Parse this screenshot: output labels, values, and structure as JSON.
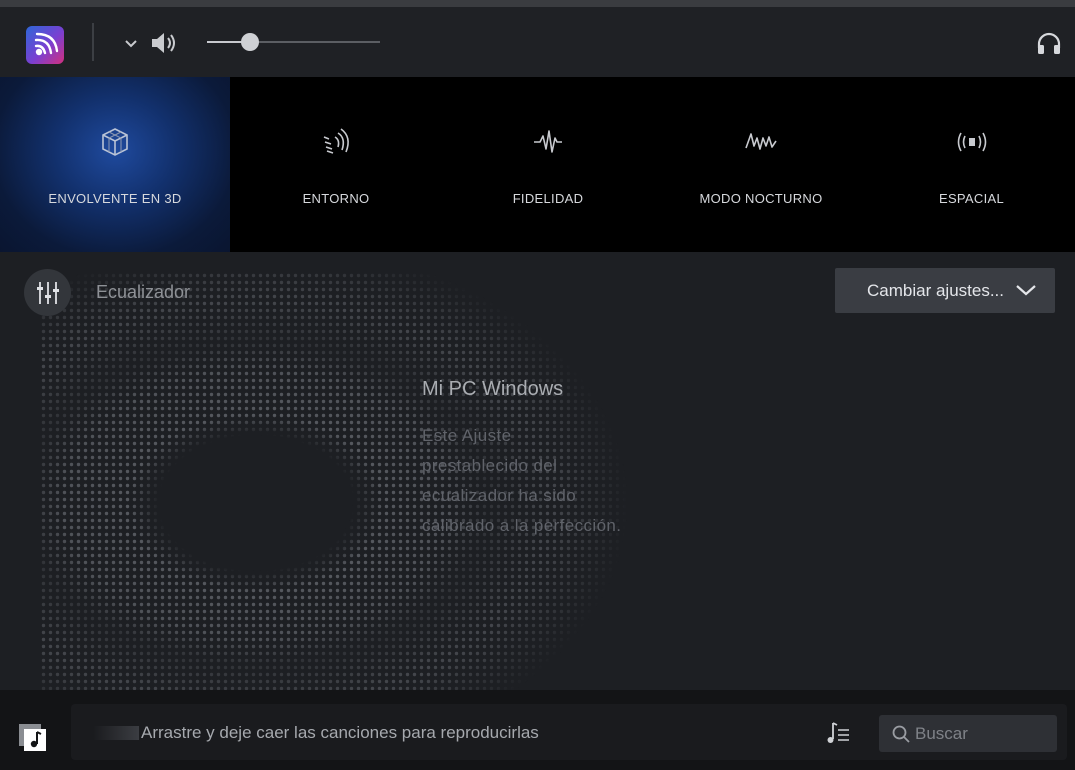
{
  "header": {
    "volume_level": 0.25,
    "logo_icon": "audio-wave-logo-icon",
    "output_icon": "headphones-icon"
  },
  "modes": [
    {
      "label": "ENVOLVENTE EN 3D",
      "icon": "cube-3d-icon",
      "active": true
    },
    {
      "label": "ENTORNO",
      "icon": "ambient-waves-icon",
      "active": false
    },
    {
      "label": "FIDELIDAD",
      "icon": "pulse-wave-icon",
      "active": false
    },
    {
      "label": "MODO NOCTURNO",
      "icon": "night-wave-icon",
      "active": false
    },
    {
      "label": "ESPACIAL",
      "icon": "spatial-broadcast-icon",
      "active": false
    }
  ],
  "equalizer": {
    "title": "Ecualizador",
    "change_label": "Cambiar ajustes...",
    "preset_name": "Mi PC Windows",
    "preset_description": "Este Ajuste prestablecido del ecualizador ha sido calibrado a la perfección."
  },
  "footer": {
    "drop_text": "Arrastre y deje caer las canciones para reproducirlas",
    "search_placeholder": "Buscar",
    "search_value": ""
  },
  "colors": {
    "accent_active": "#12306c",
    "background": "#1d1f23",
    "mode_bar": "#000000"
  }
}
